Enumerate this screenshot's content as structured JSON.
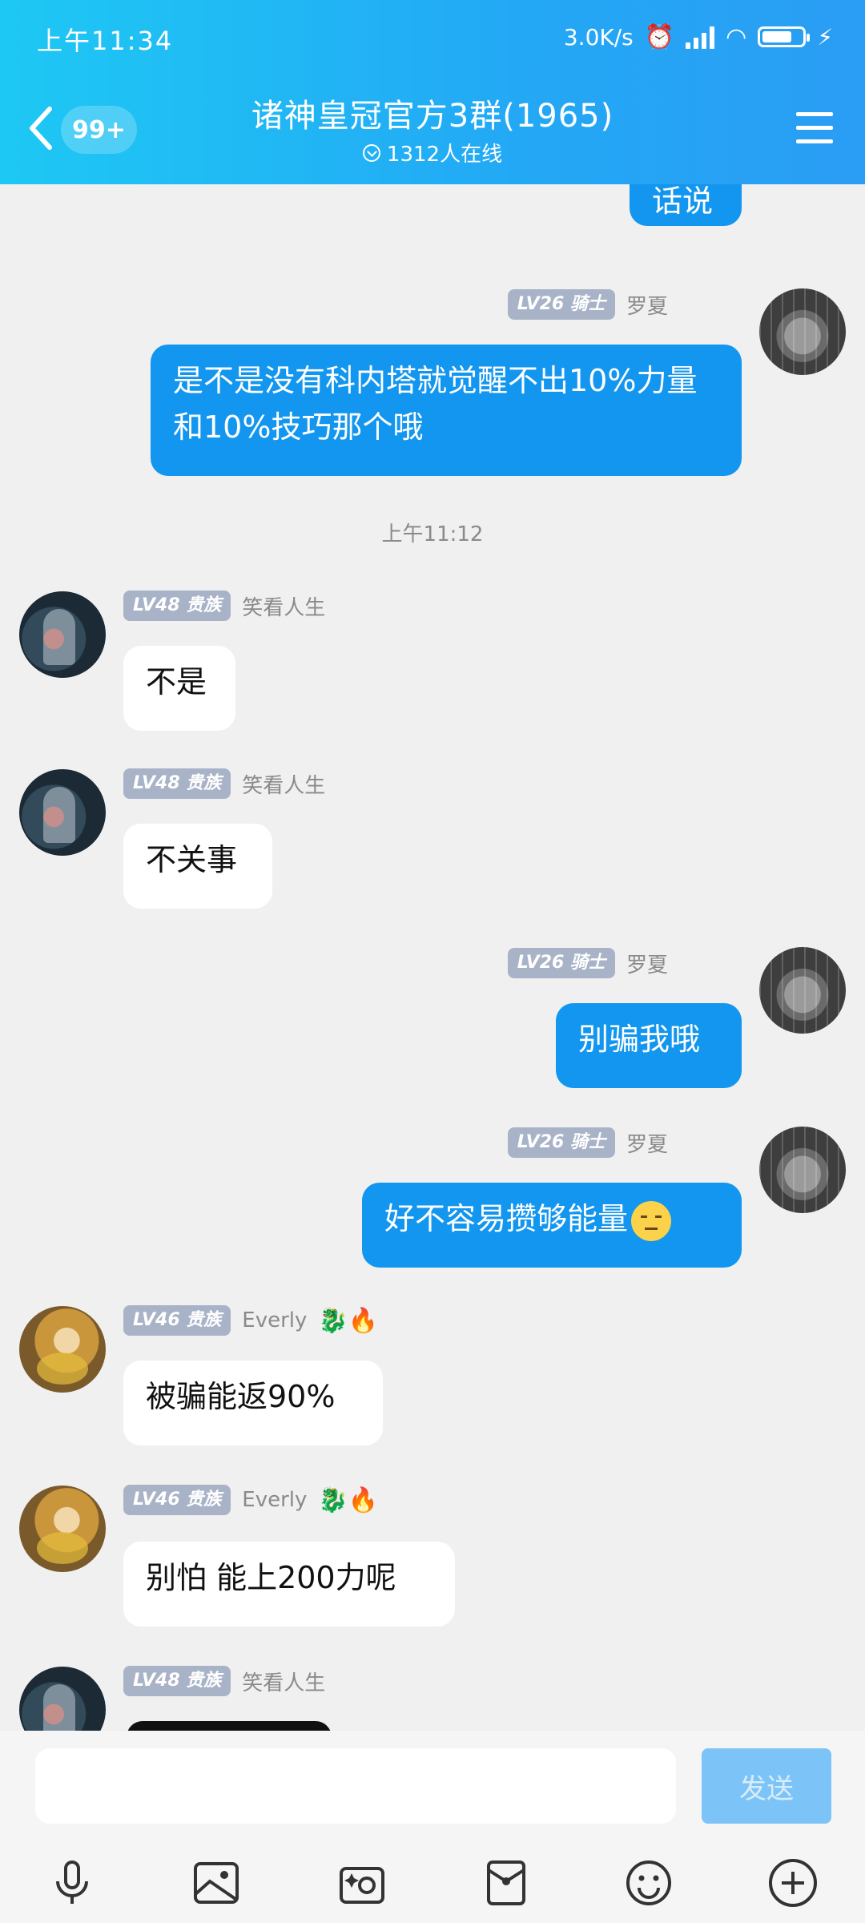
{
  "status_bar": {
    "time": "上午11:34",
    "net_speed": "3.0K/s",
    "battery_level": 0.75
  },
  "header": {
    "unread_badge": "99+",
    "title": "诸神皇冠官方3群(1965)",
    "online": "1312人在线"
  },
  "chat": {
    "top_partial_text": "话说",
    "time_separator": "上午11:12",
    "messages": [
      {
        "side": "out",
        "level": "LV26 骑士",
        "nick": "罗夏",
        "text": "是不是没有科内塔就觉醒不出10%力量和10%技巧那个哦"
      },
      {
        "side": "in",
        "level": "LV48 贵族",
        "nick": "笑看人生",
        "text": "不是"
      },
      {
        "side": "in",
        "level": "LV48 贵族",
        "nick": "笑看人生",
        "text": "不关事"
      },
      {
        "side": "out",
        "level": "LV26 骑士",
        "nick": "罗夏",
        "text": "别骗我哦"
      },
      {
        "side": "out",
        "level": "LV26 骑士",
        "nick": "罗夏",
        "text": "好不容易攒够能量"
      },
      {
        "side": "in",
        "level": "LV46 贵族",
        "nick": "Everly",
        "badges": "🐉🔥",
        "text": "被骗能返90%"
      },
      {
        "side": "in",
        "level": "LV46 贵族",
        "nick": "Everly",
        "badges": "🐉🔥",
        "text": "别怕 能上200力呢"
      },
      {
        "side": "in",
        "level": "LV48 贵族",
        "nick": "笑看人生",
        "text": ""
      }
    ]
  },
  "input": {
    "send_label": "发送",
    "placeholder": ""
  },
  "toolbar": [
    "voice-icon",
    "image-icon",
    "camera-icon",
    "red-packet-icon",
    "emoji-icon",
    "plus-icon"
  ],
  "colors": {
    "header_start": "#1ec8f4",
    "header_end": "#2a9df4",
    "out_bubble": "#1296ef",
    "in_bubble": "#ffffff",
    "send_button": "#7cc4f8"
  }
}
